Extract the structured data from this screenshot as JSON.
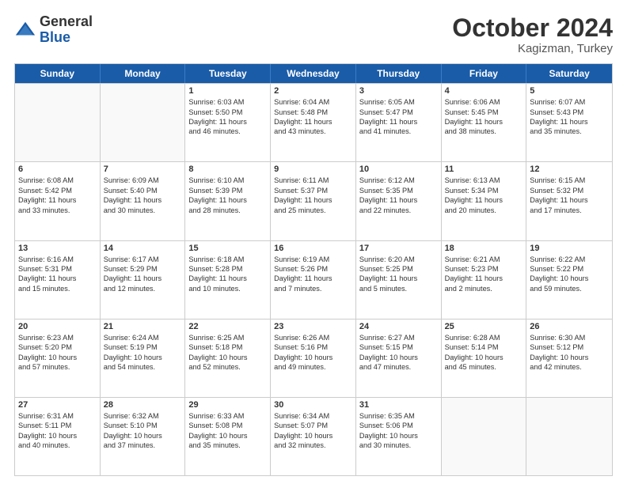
{
  "header": {
    "logo_general": "General",
    "logo_blue": "Blue",
    "month_title": "October 2024",
    "location": "Kagizman, Turkey"
  },
  "days_of_week": [
    "Sunday",
    "Monday",
    "Tuesday",
    "Wednesday",
    "Thursday",
    "Friday",
    "Saturday"
  ],
  "weeks": [
    [
      {
        "day": "",
        "empty": true
      },
      {
        "day": "",
        "empty": true
      },
      {
        "day": "1",
        "lines": [
          "Sunrise: 6:03 AM",
          "Sunset: 5:50 PM",
          "Daylight: 11 hours",
          "and 46 minutes."
        ]
      },
      {
        "day": "2",
        "lines": [
          "Sunrise: 6:04 AM",
          "Sunset: 5:48 PM",
          "Daylight: 11 hours",
          "and 43 minutes."
        ]
      },
      {
        "day": "3",
        "lines": [
          "Sunrise: 6:05 AM",
          "Sunset: 5:47 PM",
          "Daylight: 11 hours",
          "and 41 minutes."
        ]
      },
      {
        "day": "4",
        "lines": [
          "Sunrise: 6:06 AM",
          "Sunset: 5:45 PM",
          "Daylight: 11 hours",
          "and 38 minutes."
        ]
      },
      {
        "day": "5",
        "lines": [
          "Sunrise: 6:07 AM",
          "Sunset: 5:43 PM",
          "Daylight: 11 hours",
          "and 35 minutes."
        ]
      }
    ],
    [
      {
        "day": "6",
        "lines": [
          "Sunrise: 6:08 AM",
          "Sunset: 5:42 PM",
          "Daylight: 11 hours",
          "and 33 minutes."
        ]
      },
      {
        "day": "7",
        "lines": [
          "Sunrise: 6:09 AM",
          "Sunset: 5:40 PM",
          "Daylight: 11 hours",
          "and 30 minutes."
        ]
      },
      {
        "day": "8",
        "lines": [
          "Sunrise: 6:10 AM",
          "Sunset: 5:39 PM",
          "Daylight: 11 hours",
          "and 28 minutes."
        ]
      },
      {
        "day": "9",
        "lines": [
          "Sunrise: 6:11 AM",
          "Sunset: 5:37 PM",
          "Daylight: 11 hours",
          "and 25 minutes."
        ]
      },
      {
        "day": "10",
        "lines": [
          "Sunrise: 6:12 AM",
          "Sunset: 5:35 PM",
          "Daylight: 11 hours",
          "and 22 minutes."
        ]
      },
      {
        "day": "11",
        "lines": [
          "Sunrise: 6:13 AM",
          "Sunset: 5:34 PM",
          "Daylight: 11 hours",
          "and 20 minutes."
        ]
      },
      {
        "day": "12",
        "lines": [
          "Sunrise: 6:15 AM",
          "Sunset: 5:32 PM",
          "Daylight: 11 hours",
          "and 17 minutes."
        ]
      }
    ],
    [
      {
        "day": "13",
        "lines": [
          "Sunrise: 6:16 AM",
          "Sunset: 5:31 PM",
          "Daylight: 11 hours",
          "and 15 minutes."
        ]
      },
      {
        "day": "14",
        "lines": [
          "Sunrise: 6:17 AM",
          "Sunset: 5:29 PM",
          "Daylight: 11 hours",
          "and 12 minutes."
        ]
      },
      {
        "day": "15",
        "lines": [
          "Sunrise: 6:18 AM",
          "Sunset: 5:28 PM",
          "Daylight: 11 hours",
          "and 10 minutes."
        ]
      },
      {
        "day": "16",
        "lines": [
          "Sunrise: 6:19 AM",
          "Sunset: 5:26 PM",
          "Daylight: 11 hours",
          "and 7 minutes."
        ]
      },
      {
        "day": "17",
        "lines": [
          "Sunrise: 6:20 AM",
          "Sunset: 5:25 PM",
          "Daylight: 11 hours",
          "and 5 minutes."
        ]
      },
      {
        "day": "18",
        "lines": [
          "Sunrise: 6:21 AM",
          "Sunset: 5:23 PM",
          "Daylight: 11 hours",
          "and 2 minutes."
        ]
      },
      {
        "day": "19",
        "lines": [
          "Sunrise: 6:22 AM",
          "Sunset: 5:22 PM",
          "Daylight: 10 hours",
          "and 59 minutes."
        ]
      }
    ],
    [
      {
        "day": "20",
        "lines": [
          "Sunrise: 6:23 AM",
          "Sunset: 5:20 PM",
          "Daylight: 10 hours",
          "and 57 minutes."
        ]
      },
      {
        "day": "21",
        "lines": [
          "Sunrise: 6:24 AM",
          "Sunset: 5:19 PM",
          "Daylight: 10 hours",
          "and 54 minutes."
        ]
      },
      {
        "day": "22",
        "lines": [
          "Sunrise: 6:25 AM",
          "Sunset: 5:18 PM",
          "Daylight: 10 hours",
          "and 52 minutes."
        ]
      },
      {
        "day": "23",
        "lines": [
          "Sunrise: 6:26 AM",
          "Sunset: 5:16 PM",
          "Daylight: 10 hours",
          "and 49 minutes."
        ]
      },
      {
        "day": "24",
        "lines": [
          "Sunrise: 6:27 AM",
          "Sunset: 5:15 PM",
          "Daylight: 10 hours",
          "and 47 minutes."
        ]
      },
      {
        "day": "25",
        "lines": [
          "Sunrise: 6:28 AM",
          "Sunset: 5:14 PM",
          "Daylight: 10 hours",
          "and 45 minutes."
        ]
      },
      {
        "day": "26",
        "lines": [
          "Sunrise: 6:30 AM",
          "Sunset: 5:12 PM",
          "Daylight: 10 hours",
          "and 42 minutes."
        ]
      }
    ],
    [
      {
        "day": "27",
        "lines": [
          "Sunrise: 6:31 AM",
          "Sunset: 5:11 PM",
          "Daylight: 10 hours",
          "and 40 minutes."
        ]
      },
      {
        "day": "28",
        "lines": [
          "Sunrise: 6:32 AM",
          "Sunset: 5:10 PM",
          "Daylight: 10 hours",
          "and 37 minutes."
        ]
      },
      {
        "day": "29",
        "lines": [
          "Sunrise: 6:33 AM",
          "Sunset: 5:08 PM",
          "Daylight: 10 hours",
          "and 35 minutes."
        ]
      },
      {
        "day": "30",
        "lines": [
          "Sunrise: 6:34 AM",
          "Sunset: 5:07 PM",
          "Daylight: 10 hours",
          "and 32 minutes."
        ]
      },
      {
        "day": "31",
        "lines": [
          "Sunrise: 6:35 AM",
          "Sunset: 5:06 PM",
          "Daylight: 10 hours",
          "and 30 minutes."
        ]
      },
      {
        "day": "",
        "empty": true
      },
      {
        "day": "",
        "empty": true
      }
    ]
  ]
}
